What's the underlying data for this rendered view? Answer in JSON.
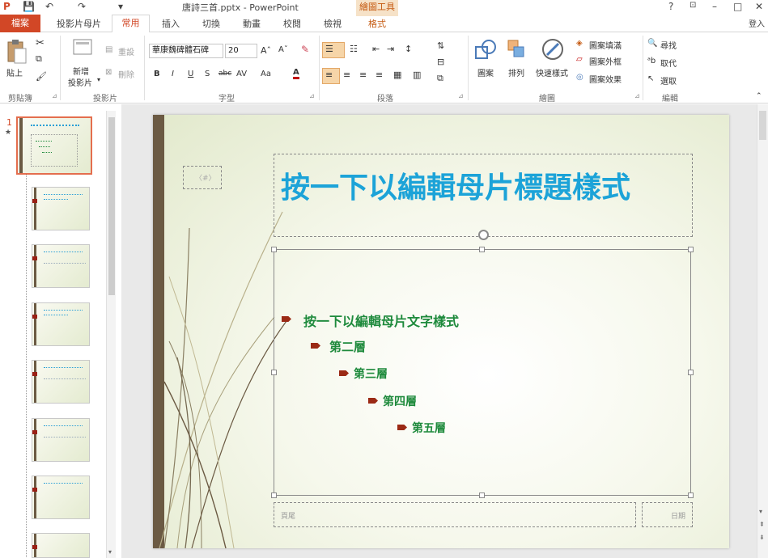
{
  "window": {
    "title": "唐詩三首.pptx - PowerPoint",
    "help": "?",
    "minimize": "–",
    "maximize": "□",
    "close": "✕",
    "signin": "登入"
  },
  "quick_access": {
    "save": "💾",
    "undo": "↶",
    "redo": "↷",
    "extra": "▾"
  },
  "tabs": {
    "file": "檔案",
    "items": [
      "投影片母片",
      "常用",
      "插入",
      "切換",
      "動畫",
      "校閱",
      "檢視",
      "格式"
    ],
    "active": "常用",
    "contextual_header": "繪圖工具"
  },
  "ribbon": {
    "clipboard": {
      "paste": "貼上",
      "label": "剪貼簿"
    },
    "slides": {
      "new_slide": "新增",
      "new_slide2": "投影片",
      "layout": "版面配置",
      "reset": "重設",
      "delete": "刪除",
      "label": "投影片"
    },
    "font": {
      "name": "華康魏碑體石碑",
      "size": "20",
      "label": "字型",
      "bold": "B",
      "italic": "I",
      "underline": "U",
      "shadow": "S",
      "strike": "abc",
      "spacing": "AV",
      "case": "Aa",
      "color": "A"
    },
    "paragraph": {
      "label": "段落"
    },
    "drawing": {
      "shapes": "圖案",
      "arrange": "排列",
      "quick_styles": "快速樣式",
      "fill": "圖案填滿",
      "outline": "圖案外框",
      "effects": "圖案效果",
      "label": "繪圖"
    },
    "editing": {
      "find": "尋找",
      "replace": "取代",
      "select": "選取",
      "label": "編輯"
    }
  },
  "thumbnails": {
    "first_number": "1",
    "first_marker": "★"
  },
  "slide": {
    "title": "按一下以編輯母片標題樣式",
    "date_placeholder": "〈#〉",
    "levels": [
      "按一下以編輯母片文字樣式",
      "第二層",
      "第三層",
      "第四層",
      "第五層"
    ],
    "footer": "頁尾",
    "page_number": "日期"
  },
  "colors": {
    "accent": "#d24726",
    "title_text": "#1ca3d8",
    "body_text": "#1e8a3c",
    "bullet": "#9b2a15",
    "side_bar": "#6b5a43"
  }
}
